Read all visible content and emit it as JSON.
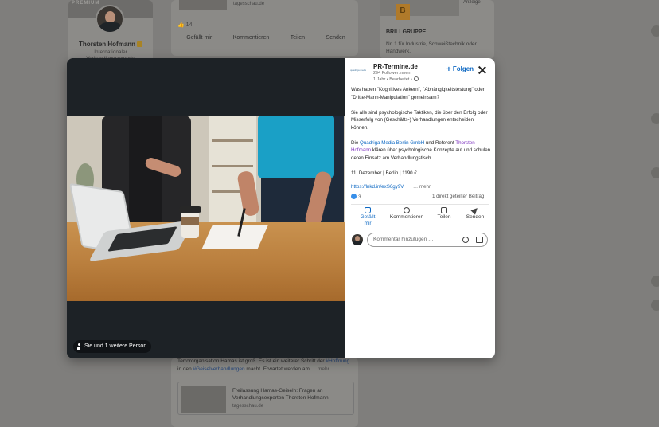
{
  "background": {
    "profile": {
      "premium_label": "PREMIUM",
      "name": "Thorsten Hofmann",
      "subtitle_line1": "Internationaler",
      "subtitle_line2": "Verhandlungsexperte"
    },
    "feed_top": {
      "source": "tagesschau.de",
      "reaction_count": "14",
      "actions": [
        "Gefällt mir",
        "Kommentieren",
        "Teilen",
        "Senden"
      ]
    },
    "ad": {
      "label": "Anzeige",
      "logo_letter": "B",
      "company": "BRILLGRUPPE",
      "description": "Nr. 1 für Industrie, Schweißtechnik oder Handwerk."
    },
    "feed_bottom": {
      "text_line1": "Terrororganisation Hamas ist groß. Es ist ein weiterer Schritt der",
      "hashtag1": "#Hoffnung",
      "text_line2a": "in den",
      "hashtag2": "#Geiselverhandlungen",
      "text_line2b": "macht. Erwartet werden am",
      "more": "… mehr",
      "link_title": "Freilassung Hamas-Geiseln: Fragen an Verhandlungsexperten Thorsten Hofmann",
      "link_source": "tagesschau.de"
    }
  },
  "modal": {
    "tag_pill": "Sie und 1 weitere Person",
    "company": {
      "logo_text": "quadriga media",
      "name": "PR-Termine.de",
      "followers": "294 Follower:innen",
      "meta": "1 Jahr • Bearbeitet •"
    },
    "follow_label": "Folgen",
    "post": {
      "p1": "Was haben \"Kognitives Ankern\", \"Abhängigkeitstestung\" oder \"Dritte-Mann-Manipulation\" gemeinsam?",
      "p2": "Sie alle sind psychologische Taktiken, die über den Erfolg oder Misserfolg von (Geschäfts-) Verhandlungen entscheiden können.",
      "p3_before": "Die ",
      "p3_link": "Quadriga Media Berlin GmbH",
      "p3_mid": " und Referent ",
      "p3_mention": "Thorsten Hofmann",
      "p3_after": " klären über psychologische Konzepte auf und schulen deren Einsatz am Verhandlungstisch.",
      "p4": "11. Dezember | Berlin | 1190 €",
      "url": "https://lnkd.in/exS6gy9V",
      "more": "… mehr"
    },
    "stats": {
      "reactions": "3",
      "reposts": "1 direkt geteilter Beitrag"
    },
    "actions": {
      "like_line1": "Gefällt",
      "like_line2": "mir",
      "comment": "Kommentieren",
      "repost": "Teilen",
      "send": "Senden"
    },
    "comment_placeholder": "Kommentar hinzufügen …"
  }
}
